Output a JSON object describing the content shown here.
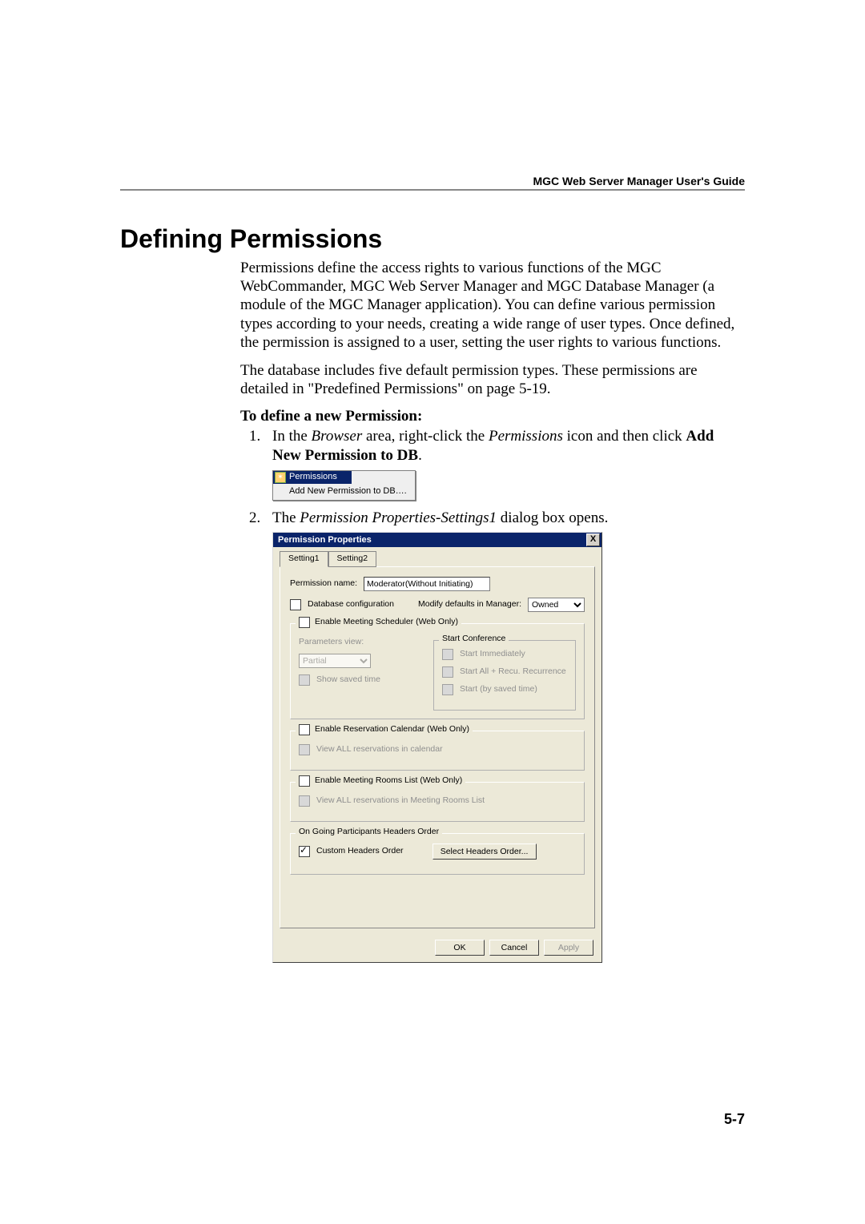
{
  "header": {
    "running_head": "MGC Web Server Manager User's Guide",
    "title": "Defining Permissions",
    "page_number": "5-7"
  },
  "paragraphs": {
    "p1": "Permissions define the access rights to various functions of the MGC WebCommander, MGC Web Server Manager and MGC Database Manager (a module of the MGC Manager application). You can define various permission types according to your needs, creating a wide range of user types. Once defined, the permission is assigned to a user, setting the user rights to various functions.",
    "p2": "The database includes five default permission types. These permissions are detailed in \"Predefined Permissions\" on page 5-19.",
    "subhead": "To define a new Permission:",
    "step1_prefix": "In the ",
    "step1_browser": "Browser",
    "step1_mid": " area, right-click the ",
    "step1_perm": "Permissions",
    "step1_post": " icon and then click ",
    "step1_action": "Add New Permission to DB",
    "step1_dot": ".",
    "step2_prefix": "The ",
    "step2_dlg": "Permission Properties-Settings1",
    "step2_post": " dialog box opens."
  },
  "context_menu": {
    "label_permissions": "Permissions",
    "menu_item": "Add New Permission to DB…."
  },
  "dialog": {
    "title": "Permission Properties",
    "close": "X",
    "tabs": {
      "t1": "Setting1",
      "t2": "Setting2"
    },
    "permission_name_label": "Permission name:",
    "permission_name_value": "Moderator(Without Initiating)",
    "db_cfg_label": "Database configuration",
    "modify_defaults_label": "Modify defaults in Manager:",
    "modify_defaults_value": "Owned",
    "group_scheduler": "Enable Meeting Scheduler (Web Only)",
    "param_view_label": "Parameters view:",
    "param_view_value": "Partial",
    "show_saved_time": "Show saved time",
    "start_conf_legend": "Start Conference",
    "start_immediately": "Start Immediately",
    "start_all_recur": "Start All + Recu. Recurrence",
    "start_by_saved": "Start (by saved time)",
    "group_calendar": "Enable Reservation Calendar (Web Only)",
    "view_all_calendar": "View ALL reservations in calendar",
    "group_rooms": "Enable Meeting Rooms List (Web Only)",
    "view_all_rooms": "View ALL reservations in Meeting Rooms List",
    "group_headers": "On Going Participants Headers Order",
    "custom_headers": "Custom Headers Order",
    "select_headers_btn": "Select Headers Order...",
    "btn_ok": "OK",
    "btn_cancel": "Cancel",
    "btn_apply": "Apply"
  }
}
